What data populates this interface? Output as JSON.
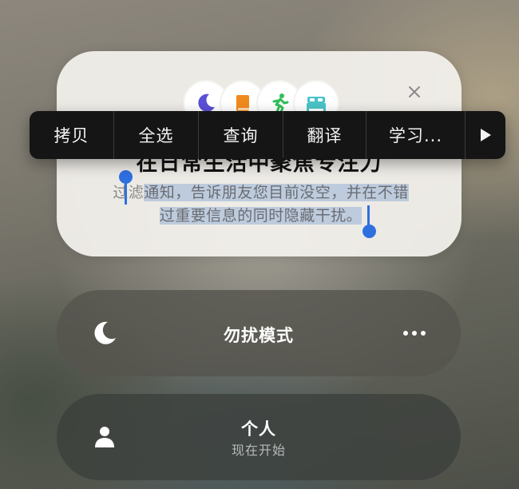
{
  "card": {
    "icons": [
      "moon-icon",
      "book-icon",
      "running-person-icon",
      "bed-icon"
    ],
    "title": "在日常生活中聚焦专注力",
    "description_line1_prefix": "过滤",
    "description_line1_selected": "通知，告诉朋友您目前没空，并在不错",
    "description_line2_selected": "过重要信息的同时隐藏干扰。"
  },
  "context_menu": {
    "items": [
      "拷贝",
      "全选",
      "查询",
      "翻译",
      "学习..."
    ],
    "more_icon": "triangle-right-icon"
  },
  "focus_modes": [
    {
      "title": "勿扰模式",
      "icon": "moon-icon"
    },
    {
      "title": "个人",
      "subtitle": "现在开始",
      "icon": "person-icon"
    }
  ],
  "colors": {
    "selection_handle": "#2f6fe0",
    "moon": "#5a4fd6",
    "book": "#f08a1e",
    "running": "#2fbf5a",
    "bed": "#49c3c7"
  }
}
